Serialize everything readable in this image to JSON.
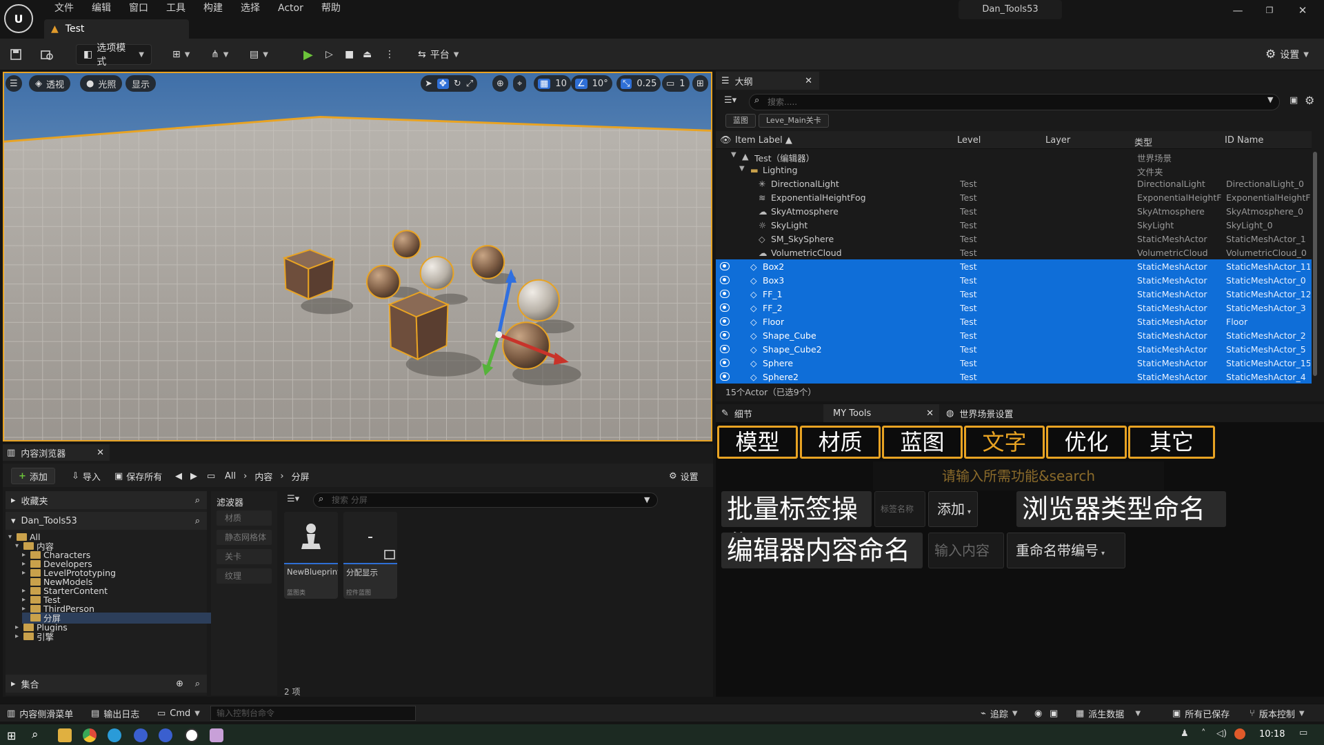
{
  "title_bar": {
    "logo_text": "U",
    "menus": [
      "文件",
      "编辑",
      "窗口",
      "工具",
      "构建",
      "选择",
      "Actor",
      "帮助"
    ],
    "project_name": "Dan_Tools53",
    "window_controls": [
      "—",
      "❐",
      "✕"
    ]
  },
  "document_tab": {
    "label": "Test"
  },
  "toolbar": {
    "select_mode_label": "选项模式",
    "platform_label": "平台",
    "settings_label": "设置"
  },
  "viewport": {
    "perspective_label": "透视",
    "lighting_label": "光照",
    "show_label": "显示",
    "grid_snap": "10",
    "rotation_snap": "10°",
    "scale_snap": "0.25",
    "camera_speed": "1"
  },
  "outliner": {
    "tab_label": "大纲",
    "search_placeholder": "搜索.....",
    "chips": [
      "蓝图",
      "Leve_Main关卡"
    ],
    "columns": [
      "Item Label ▲",
      "Level",
      "Layer",
      "类型",
      "ID Name"
    ],
    "rows": [
      {
        "label": "Test（编辑器）",
        "level": "",
        "type": "世界场景",
        "id": "",
        "selected": false,
        "indent": 1,
        "icon": "world"
      },
      {
        "label": "Lighting",
        "level": "",
        "type": "文件夹",
        "id": "",
        "selected": false,
        "indent": 2,
        "icon": "folder"
      },
      {
        "label": "DirectionalLight",
        "level": "Test",
        "type": "DirectionalLight",
        "id": "DirectionalLight_0",
        "selected": false,
        "indent": 3,
        "icon": "light"
      },
      {
        "label": "ExponentialHeightFog",
        "level": "Test",
        "type": "ExponentialHeightFog",
        "id": "ExponentialHeightFog",
        "selected": false,
        "indent": 3,
        "icon": "fog"
      },
      {
        "label": "SkyAtmosphere",
        "level": "Test",
        "type": "SkyAtmosphere",
        "id": "SkyAtmosphere_0",
        "selected": false,
        "indent": 3,
        "icon": "sky"
      },
      {
        "label": "SkyLight",
        "level": "Test",
        "type": "SkyLight",
        "id": "SkyLight_0",
        "selected": false,
        "indent": 3,
        "icon": "skylight"
      },
      {
        "label": "SM_SkySphere",
        "level": "Test",
        "type": "StaticMeshActor",
        "id": "StaticMeshActor_1",
        "selected": false,
        "indent": 3,
        "icon": "mesh"
      },
      {
        "label": "VolumetricCloud",
        "level": "Test",
        "type": "VolumetricCloud",
        "id": "VolumetricCloud_0",
        "selected": false,
        "indent": 3,
        "icon": "cloud"
      },
      {
        "label": "Box2",
        "level": "Test",
        "type": "StaticMeshActor",
        "id": "StaticMeshActor_11",
        "selected": true,
        "indent": 2,
        "icon": "mesh"
      },
      {
        "label": "Box3",
        "level": "Test",
        "type": "StaticMeshActor",
        "id": "StaticMeshActor_0",
        "selected": true,
        "indent": 2,
        "icon": "mesh"
      },
      {
        "label": "FF_1",
        "level": "Test",
        "type": "StaticMeshActor",
        "id": "StaticMeshActor_12",
        "selected": true,
        "indent": 2,
        "icon": "mesh"
      },
      {
        "label": "FF_2",
        "level": "Test",
        "type": "StaticMeshActor",
        "id": "StaticMeshActor_3",
        "selected": true,
        "indent": 2,
        "icon": "mesh"
      },
      {
        "label": "Floor",
        "level": "Test",
        "type": "StaticMeshActor",
        "id": "Floor",
        "selected": true,
        "indent": 2,
        "icon": "mesh"
      },
      {
        "label": "Shape_Cube",
        "level": "Test",
        "type": "StaticMeshActor",
        "id": "StaticMeshActor_2",
        "selected": true,
        "indent": 2,
        "icon": "mesh"
      },
      {
        "label": "Shape_Cube2",
        "level": "Test",
        "type": "StaticMeshActor",
        "id": "StaticMeshActor_5",
        "selected": true,
        "indent": 2,
        "icon": "mesh"
      },
      {
        "label": "Sphere",
        "level": "Test",
        "type": "StaticMeshActor",
        "id": "StaticMeshActor_15",
        "selected": true,
        "indent": 2,
        "icon": "mesh"
      },
      {
        "label": "Sphere2",
        "level": "Test",
        "type": "StaticMeshActor",
        "id": "StaticMeshActor_4",
        "selected": true,
        "indent": 2,
        "icon": "mesh"
      }
    ],
    "footer": "15个Actor（已选9个）"
  },
  "details": {
    "tabs": [
      "细节",
      "MY Tools",
      "世界场景设置"
    ],
    "category_buttons": [
      "模型",
      "材质",
      "蓝图",
      "文字",
      "优化",
      "其它"
    ],
    "active_category_index": 3,
    "search_hint": "请输入所需功能&search",
    "batch_tag_label": "批量标签操作",
    "tag_name_placeholder": "标签名称",
    "add_dropdown": "添加",
    "browser_rename_label": "浏览器类型命名",
    "editor_rename_label": "编辑器内容命名",
    "input_placeholder": "输入内容",
    "rename_dropdown": "重命名带编号"
  },
  "content_browser": {
    "tab_label": "内容浏览器",
    "add_label": "添加",
    "import_label": "导入",
    "save_all_label": "保存所有",
    "breadcrumb": [
      "All",
      "内容",
      "分屏"
    ],
    "settings_label": "设置",
    "favorites_label": "收藏夹",
    "project_label": "Dan_Tools53",
    "tree": [
      {
        "label": "All",
        "indent": 0,
        "expanded": true,
        "selected": false
      },
      {
        "label": "内容",
        "indent": 1,
        "expanded": true,
        "selected": false
      },
      {
        "label": "Characters",
        "indent": 2,
        "expanded": false,
        "selected": false
      },
      {
        "label": "Developers",
        "indent": 2,
        "expanded": false,
        "selected": false
      },
      {
        "label": "LevelPrototyping",
        "indent": 2,
        "expanded": false,
        "selected": false
      },
      {
        "label": "NewModels",
        "indent": 2,
        "expanded": null,
        "selected": false
      },
      {
        "label": "StarterContent",
        "indent": 2,
        "expanded": false,
        "selected": false
      },
      {
        "label": "Test",
        "indent": 2,
        "expanded": false,
        "selected": false
      },
      {
        "label": "ThirdPerson",
        "indent": 2,
        "expanded": false,
        "selected": false
      },
      {
        "label": "分屏",
        "indent": 2,
        "expanded": null,
        "selected": true
      },
      {
        "label": "Plugins",
        "indent": 1,
        "expanded": false,
        "selected": false
      },
      {
        "label": "引擎",
        "indent": 1,
        "expanded": false,
        "selected": false
      }
    ],
    "collections_label": "集合",
    "filters_label": "滤波器",
    "filters": [
      "材质",
      "静态网格体",
      "关卡",
      "纹理"
    ],
    "search_placeholder": "搜索 分屏",
    "assets": [
      {
        "name": "NewBlueprint",
        "type": "蓝图类"
      },
      {
        "name": "分配显示",
        "type": "控件蓝图"
      }
    ],
    "item_count": "2 项"
  },
  "status_bar": {
    "content_drawer": "内容侧滑菜单",
    "output_log": "输出日志",
    "cmd_label": "Cmd",
    "console_placeholder": "输入控制台命令",
    "trace_label": "追踪",
    "derived_data_label": "派生数据",
    "all_saved_label": "所有已保存",
    "source_control_label": "版本控制"
  },
  "taskbar": {
    "time": "10:18"
  },
  "colors": {
    "selection": "#0f6ed8",
    "accent_orange": "#e8a323",
    "play_green": "#6cc43a"
  }
}
